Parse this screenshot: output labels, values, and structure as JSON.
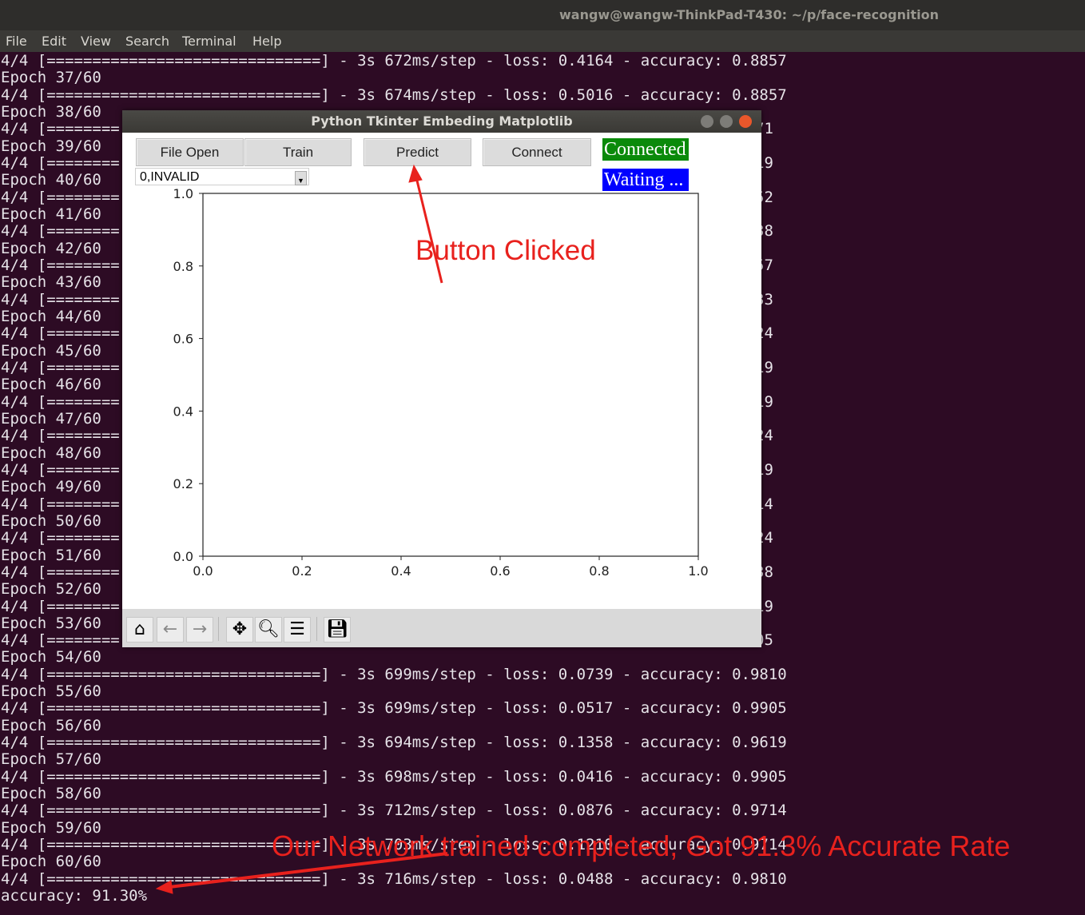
{
  "terminal": {
    "title": "wangw@wangw-ThinkPad-T430: ~/p/face-recognition",
    "menu": [
      "File",
      "Edit",
      "View",
      "Search",
      "Terminal",
      "Help"
    ],
    "lines": [
      {
        "text": "4/4 [==============================] - 3s 672ms/step - loss: 0.4164 - accuracy: 0.8857"
      },
      {
        "text": "Epoch 37/60"
      },
      {
        "text": "4/4 [==============================] - 3s 674ms/step - loss: 0.5016 - accuracy: 0.8857"
      },
      {
        "text": "Epoch 38/60"
      },
      {
        "text": "4/4 [========",
        "frag": "71"
      },
      {
        "text": "Epoch 39/60"
      },
      {
        "text": "4/4 [========",
        "frag": "19"
      },
      {
        "text": "Epoch 40/60"
      },
      {
        "text": "4/4 [========",
        "frag": "52"
      },
      {
        "text": "Epoch 41/60"
      },
      {
        "text": "4/4 [========",
        "frag": "38"
      },
      {
        "text": "Epoch 42/60"
      },
      {
        "text": "4/4 [========",
        "frag": "57"
      },
      {
        "text": "Epoch 43/60"
      },
      {
        "text": "4/4 [========",
        "frag": "33"
      },
      {
        "text": "Epoch 44/60"
      },
      {
        "text": "4/4 [========",
        "frag": "24"
      },
      {
        "text": "Epoch 45/60"
      },
      {
        "text": "4/4 [========",
        "frag": "19"
      },
      {
        "text": "Epoch 46/60"
      },
      {
        "text": "4/4 [========",
        "frag": "19"
      },
      {
        "text": "Epoch 47/60"
      },
      {
        "text": "4/4 [========",
        "frag": "24"
      },
      {
        "text": "Epoch 48/60"
      },
      {
        "text": "4/4 [========",
        "frag": "19"
      },
      {
        "text": "Epoch 49/60"
      },
      {
        "text": "4/4 [========",
        "frag": "14"
      },
      {
        "text": "Epoch 50/60"
      },
      {
        "text": "4/4 [========",
        "frag": "24"
      },
      {
        "text": "Epoch 51/60"
      },
      {
        "text": "4/4 [========",
        "frag": "38"
      },
      {
        "text": "Epoch 52/60"
      },
      {
        "text": "4/4 [========",
        "frag": "19"
      },
      {
        "text": "Epoch 53/60"
      },
      {
        "text": "4/4 [========",
        "frag": "05"
      },
      {
        "text": "Epoch 54/60"
      },
      {
        "text": "4/4 [==============================] - 3s 699ms/step - loss: 0.0739 - accuracy: 0.9810"
      },
      {
        "text": "Epoch 55/60"
      },
      {
        "text": "4/4 [==============================] - 3s 699ms/step - loss: 0.0517 - accuracy: 0.9905"
      },
      {
        "text": "Epoch 56/60"
      },
      {
        "text": "4/4 [==============================] - 3s 694ms/step - loss: 0.1358 - accuracy: 0.9619"
      },
      {
        "text": "Epoch 57/60"
      },
      {
        "text": "4/4 [==============================] - 3s 698ms/step - loss: 0.0416 - accuracy: 0.9905"
      },
      {
        "text": "Epoch 58/60"
      },
      {
        "text": "4/4 [==============================] - 3s 712ms/step - loss: 0.0876 - accuracy: 0.9714"
      },
      {
        "text": "Epoch 59/60"
      },
      {
        "text": "4/4 [==============================] - 3s 703ms/step - loss: 0.1210 - accuracy: 0.9714"
      },
      {
        "text": "Epoch 60/60"
      },
      {
        "text": "4/4 [==============================] - 3s 716ms/step - loss: 0.0488 - accuracy: 0.9810"
      },
      {
        "text": "accuracy: 91.30%"
      }
    ]
  },
  "app": {
    "title": "Python Tkinter Embeding Matplotlib",
    "buttons": {
      "file_open": "File Open",
      "train": "Train",
      "predict": "Predict",
      "connect": "Connect"
    },
    "status_connected": {
      "text": "Connected",
      "color": "#0a8a0a"
    },
    "status_waiting": {
      "text": "Waiting ...",
      "color": "#0000ff"
    },
    "combo_value": "0,INVALID",
    "toolbar": [
      "home-icon",
      "back-icon",
      "forward-icon",
      "pan-icon",
      "zoom-icon",
      "configure-icon",
      "save-icon"
    ]
  },
  "chart_data": {
    "type": "line",
    "series": [],
    "xlim": [
      0.0,
      1.0
    ],
    "ylim": [
      0.0,
      1.0
    ],
    "xticks": [
      "0.0",
      "0.2",
      "0.4",
      "0.6",
      "0.8",
      "1.0"
    ],
    "yticks": [
      "0.0",
      "0.2",
      "0.4",
      "0.6",
      "0.8",
      "1.0"
    ],
    "grid": false
  },
  "annotations": {
    "button_clicked": "Button Clicked",
    "result": "Our Network trained completed, Got 91.3% Accurate Rate",
    "color": "#e8211d"
  }
}
